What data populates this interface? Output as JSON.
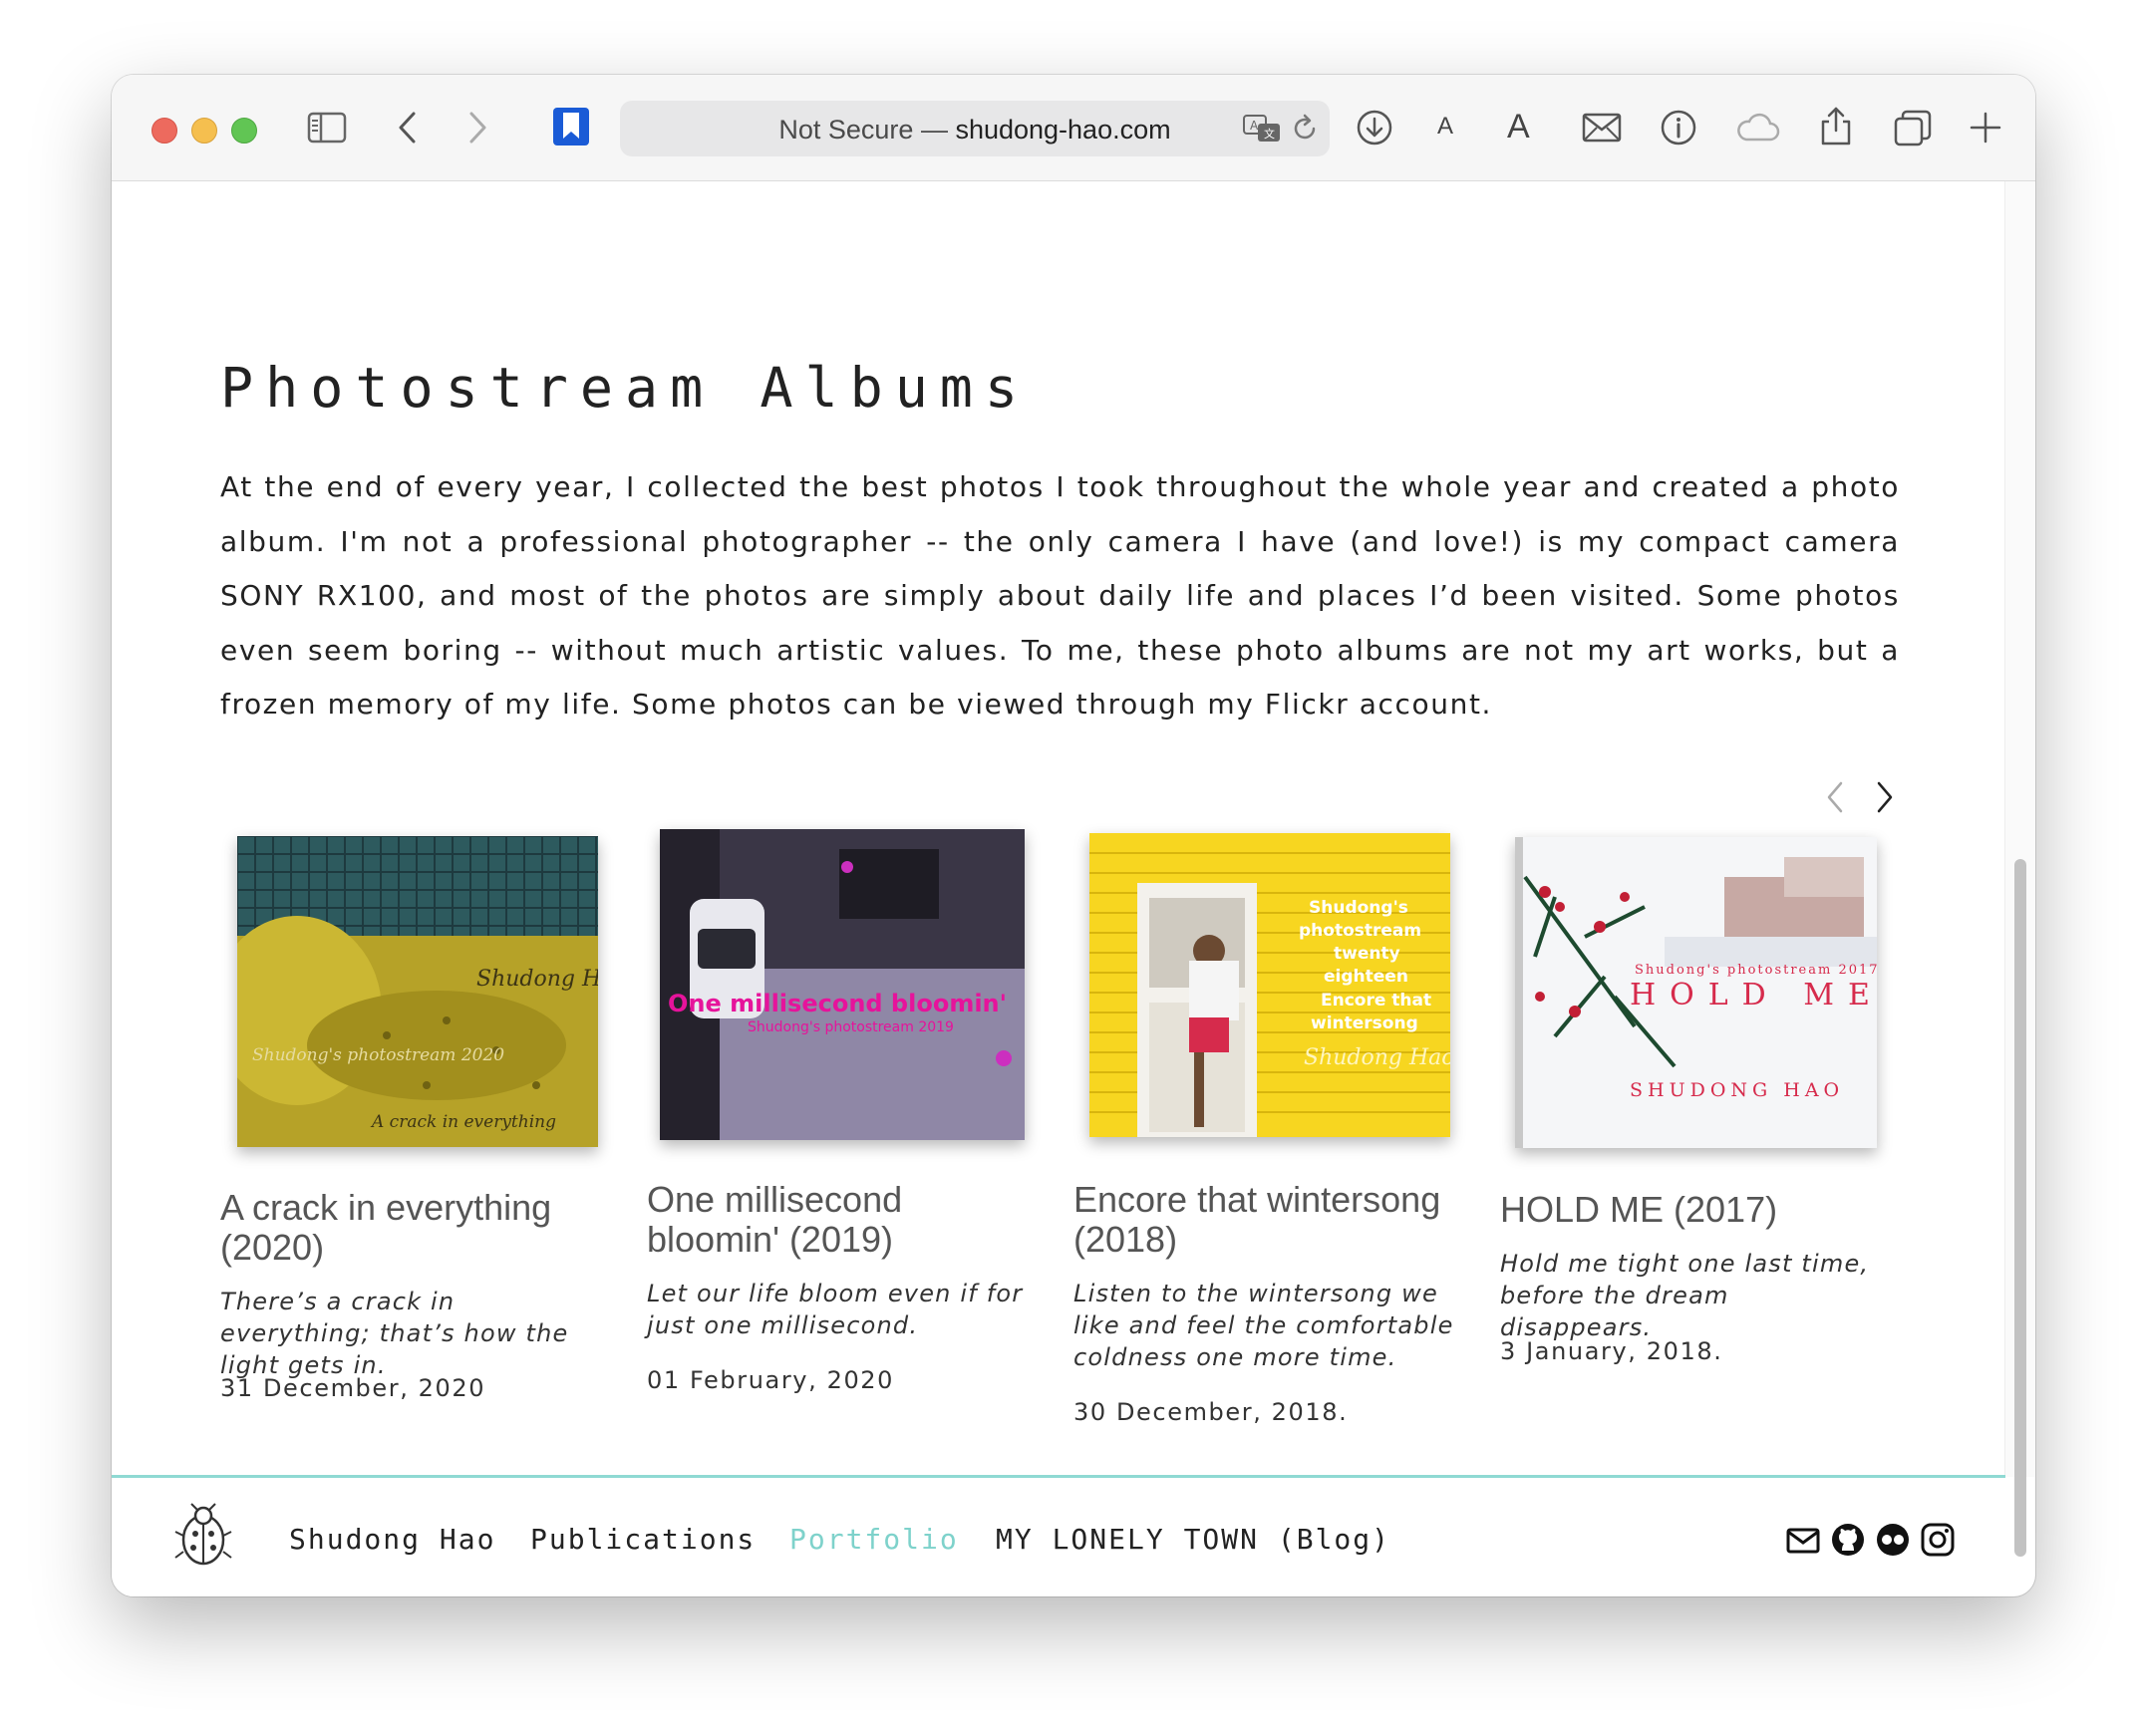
{
  "browser": {
    "address_prefix": "Not Secure — ",
    "address_domain": "shudong-hao.com",
    "font_small_label": "A",
    "font_large_label": "A"
  },
  "page": {
    "title": "Photostream Albums",
    "intro": "At the end of every year, I collected the best photos I took throughout the whole year and created a photo album. I'm not a professional photographer -- the only camera I have (and love!) is my compact camera SONY RX100, and most of the photos are simply about daily life and places I’d been visited. Some photos even seem boring -- without much artistic values. To me, these photo albums are not my art works, but a frozen memory of my life. Some photos can be viewed through my Flickr account."
  },
  "albums": [
    {
      "title": "A crack in everything (2020)",
      "description": "There’s a crack in everything; that’s how the light gets in.",
      "date": "31 December, 2020",
      "cover_text": [
        "Shudong Hao",
        "Shudong's photostream 2020",
        "A crack in everything"
      ]
    },
    {
      "title": "One millisecond bloomin' (2019)",
      "description": "Let our life bloom even if for just one millisecond.",
      "date": "01 February, 2020",
      "cover_text": [
        "One millisecond bloomin'",
        "Shudong's photostream 2019"
      ]
    },
    {
      "title": "Encore that wintersong (2018)",
      "description": "Listen to the wintersong we like and feel the comfortable coldness one more time.",
      "date": "30 December, 2018.",
      "cover_text": [
        "Shudong's",
        "photostream",
        "twenty",
        "eighteen",
        "Encore that",
        "wintersong",
        "Shudong Hao"
      ]
    },
    {
      "title": "HOLD ME (2017)",
      "description": "Hold me tight one last time, before the dream disappears.",
      "date": "3 January, 2018.",
      "cover_text": [
        "Shudong's photostream 2017",
        "HOLD ME",
        "SHUDONG HAO"
      ]
    }
  ],
  "footer": {
    "nav": [
      {
        "label": "Shudong Hao",
        "active": false
      },
      {
        "label": "Publications",
        "active": false
      },
      {
        "label": "Portfolio",
        "active": true
      },
      {
        "label": "MY LONELY TOWN (Blog)",
        "active": false
      }
    ],
    "social_icons": [
      "mail-icon",
      "github-icon",
      "flickr-icon",
      "instagram-icon"
    ]
  },
  "colors": {
    "accent": "#7ed2cb",
    "footer_border": "#8fd9d3",
    "cover_yellow": "#f5d21c",
    "cover_magenta": "#e6139b",
    "cover_red": "#d62b4c"
  }
}
